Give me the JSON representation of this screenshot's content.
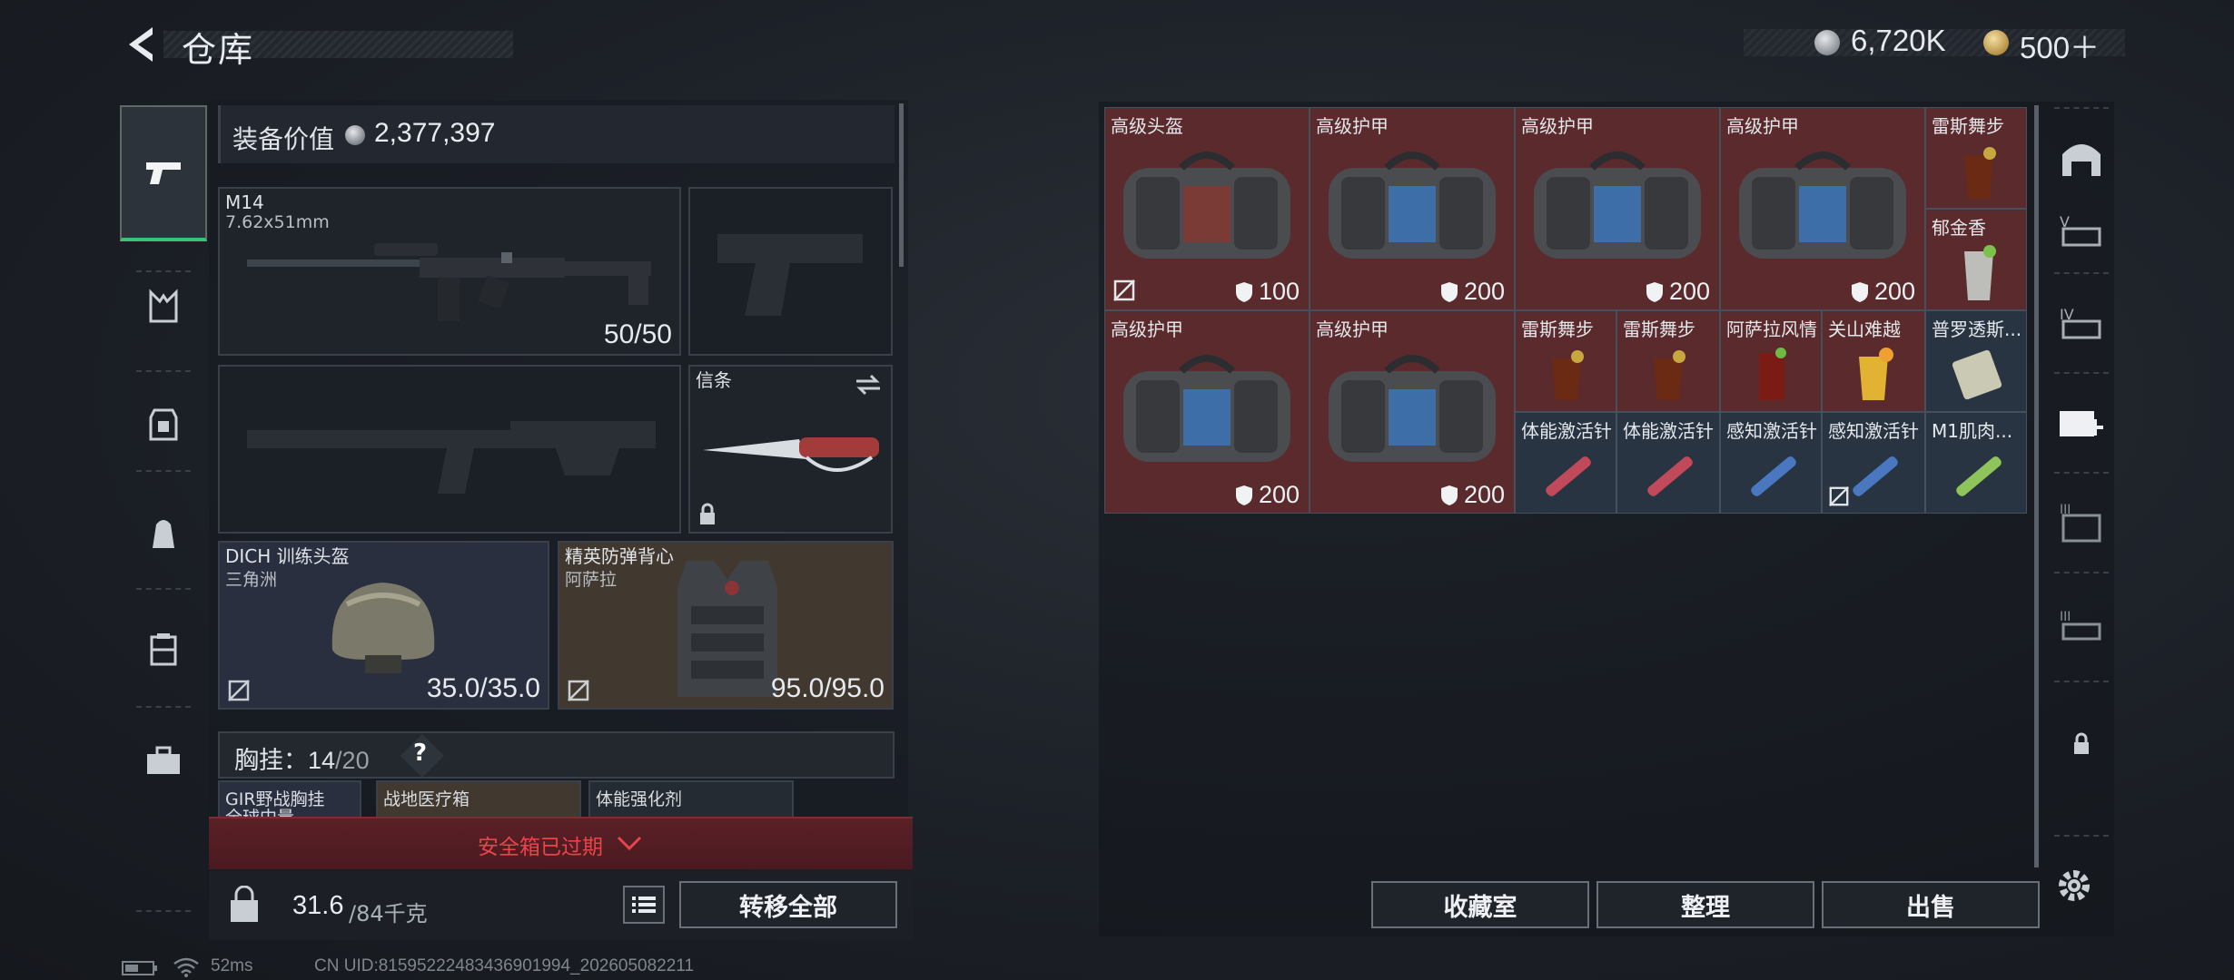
{
  "header": {
    "title": "仓库",
    "currency_1": "6,720K",
    "currency_2": "500＋"
  },
  "left_nav": {
    "items": [
      "weapon-icon",
      "chest-rig-icon",
      "armor-icon",
      "backpack-icon",
      "case-icon",
      "toolbox-icon"
    ]
  },
  "equipment": {
    "value_label": "装备价值",
    "value": "2,377,397",
    "primary_weapon": {
      "name": "M14",
      "caliber": "7.62x51mm",
      "ammo": "50/50"
    },
    "melee": {
      "name": "信条"
    },
    "helmet": {
      "name": "DICH 训练头盔",
      "sub": "三角洲",
      "durability": "35.0/35.0"
    },
    "armor": {
      "name": "精英防弹背心",
      "sub": "阿萨拉",
      "durability": "95.0/95.0"
    },
    "chest_rig": {
      "label": "胸挂：",
      "current": "14",
      "max": "/20"
    },
    "rig_items": [
      "GIR野战胸挂",
      "战地医疗箱",
      "体能强化剂"
    ],
    "rig_sub": "全球中量"
  },
  "safe_box": {
    "text": "安全箱已过期"
  },
  "bottom": {
    "weight": "31.6",
    "weight_max": "/84千克",
    "transfer_all": "转移全部",
    "collection": "收藏室",
    "organize": "整理",
    "sell": "出售"
  },
  "storage": {
    "big_items": [
      {
        "label": "高级头盔",
        "value": "100"
      },
      {
        "label": "高级护甲",
        "value": "200"
      },
      {
        "label": "高级护甲",
        "value": "200"
      },
      {
        "label": "高级护甲",
        "value": "200"
      },
      {
        "label": "高级护甲",
        "value": "200"
      },
      {
        "label": "高级护甲",
        "value": "200"
      }
    ],
    "small_items": [
      "雷斯舞步",
      "郁金香",
      "雷斯舞步",
      "雷斯舞步",
      "阿萨拉风情",
      "关山难越",
      "普罗透斯...",
      "体能激活针",
      "体能激活针",
      "感知激活针",
      "感知激活针",
      "M1肌肉..."
    ]
  },
  "status_bar": {
    "ping": "52ms",
    "uid": "CN UID:8159522248343690199​4_202605082211"
  },
  "colors": {
    "accent_green": "#39c27a",
    "expired_red": "#e8454a",
    "cell_red": "#5a2a2d",
    "cell_blue": "#293443"
  }
}
